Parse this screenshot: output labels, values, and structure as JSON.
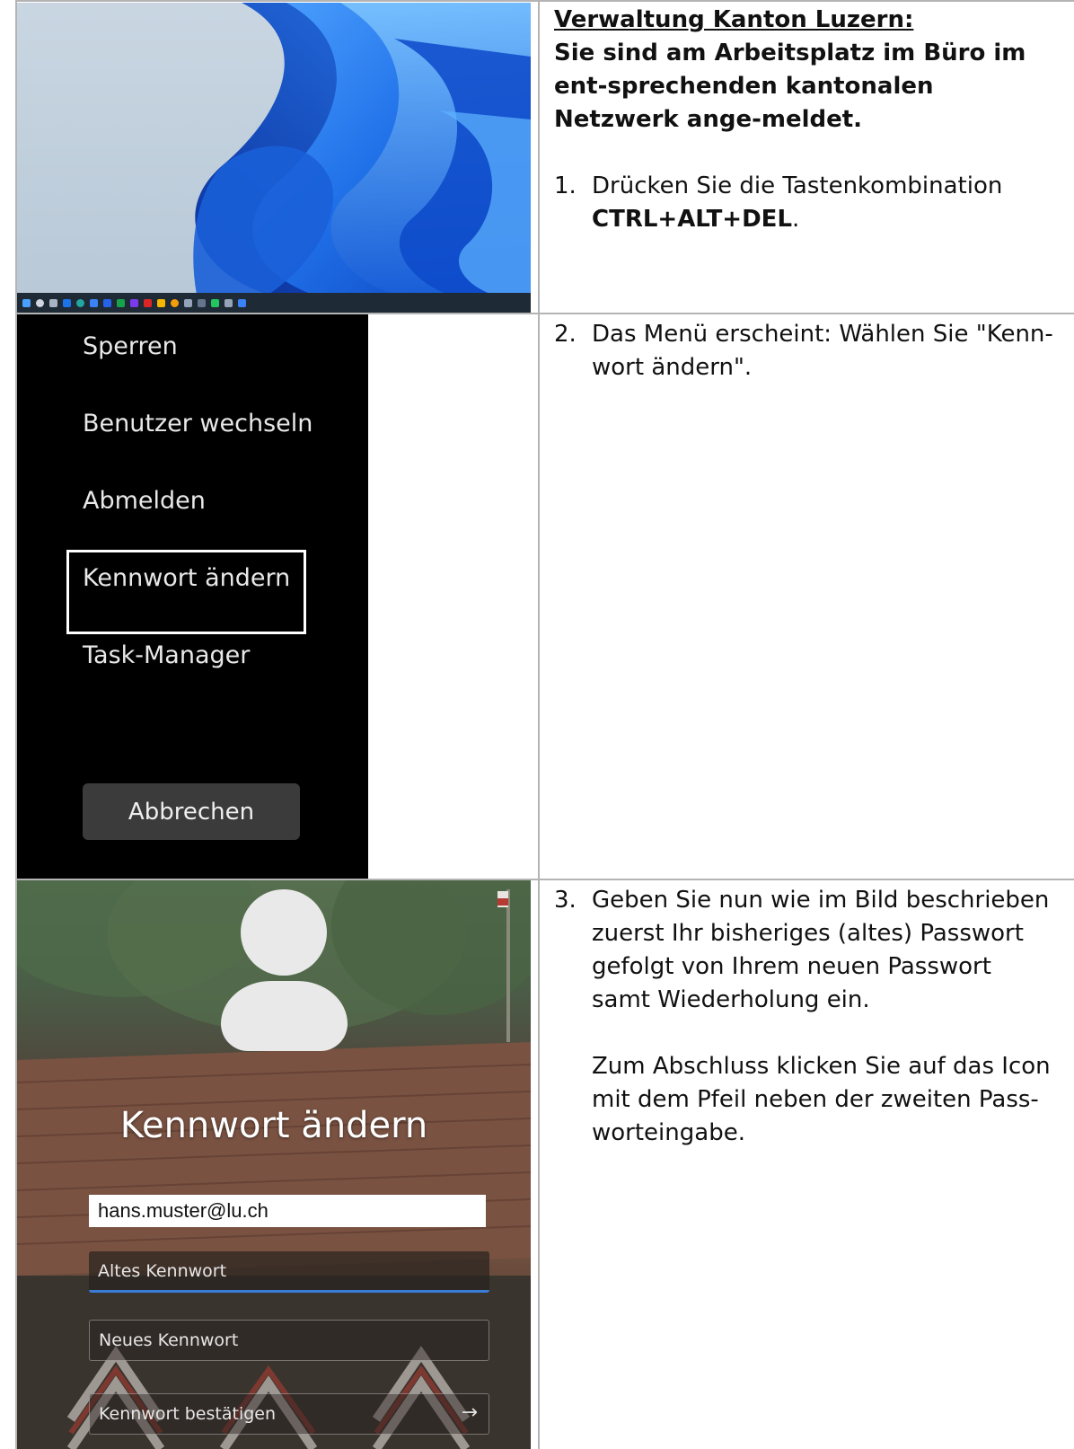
{
  "row1": {
    "heading": "Verwaltung Kanton Luzern:",
    "intro": "Sie sind am Arbeitsplatz im Büro im ent-sprechenden kantonalen Netzwerk ange-meldet.",
    "step_number": "1.",
    "step_text": "Drücken Sie die Tastenkombination",
    "step_keys": "CTRL+ALT+DEL",
    "step_end": "."
  },
  "row2": {
    "step_number": "2.",
    "step_text": "Das Menü erscheint: Wählen Sie \"Kenn-wort ändern\".",
    "menu": {
      "items": [
        "Sperren",
        "Benutzer wechseln",
        "Abmelden",
        "Kennwort ändern",
        "Task-Manager"
      ],
      "cancel_label": "Abbrechen"
    }
  },
  "row3": {
    "step_number": "3.",
    "step_text": "Geben Sie nun wie im Bild beschrieben zuerst Ihr bisheriges (altes) Passwort gefolgt von Ihrem neuen Passwort samt Wiederholung ein.",
    "step_text2": "Zum Abschluss klicken Sie auf das Icon mit dem Pfeil neben der zweiten Pass-worteingabe.",
    "dialog": {
      "title": "Kennwort ändern",
      "username_value": "hans.muster@lu.ch",
      "old_password_placeholder": "Altes Kennwort",
      "new_password_placeholder": "Neues Kennwort",
      "confirm_password_placeholder": "Kennwort bestätigen",
      "submit_icon": "arrow-right-icon"
    }
  },
  "colors": {
    "win11_bloom": "#1f6fe8",
    "highlight_border": "#ffffff",
    "menu_background": "#000000",
    "focus_underline": "#3a7bd5"
  }
}
